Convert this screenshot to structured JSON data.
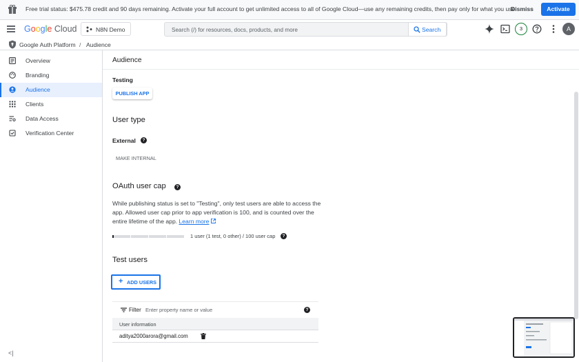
{
  "banner": {
    "message": "Free trial status: $475.78 credit and 90 days remaining. Activate your full account to get unlimited access to all of Google Cloud—use any remaining credits, then pay only for what you use.",
    "dismiss": "Dismiss",
    "activate": "Activate"
  },
  "header": {
    "logo_google": [
      "G",
      "o",
      "o",
      "g",
      "l",
      "e"
    ],
    "logo_cloud": "Cloud",
    "project": "N8N Demo",
    "search_placeholder": "Search (/) for resources, docs, products, and more",
    "search_button": "Search",
    "notifications": "3",
    "avatar": "A"
  },
  "breadcrumb": {
    "root": "Google Auth Platform",
    "separator": "/",
    "current": "Audience"
  },
  "sidebar": {
    "items": [
      {
        "label": "Overview",
        "icon": "dashboard-icon"
      },
      {
        "label": "Branding",
        "icon": "palette-icon"
      },
      {
        "label": "Audience",
        "icon": "person-icon"
      },
      {
        "label": "Clients",
        "icon": "grid-icon"
      },
      {
        "label": "Data Access",
        "icon": "data-access-icon"
      },
      {
        "label": "Verification Center",
        "icon": "verified-icon"
      }
    ],
    "active_index": 2,
    "collapse": "<|"
  },
  "main": {
    "title": "Audience",
    "status_label": "Testing",
    "publish_button": "PUBLISH APP",
    "user_type_heading": "User type",
    "user_type_value": "External",
    "make_internal": "MAKE INTERNAL",
    "cap_heading": "OAuth user cap",
    "cap_text": "While publishing status is set to \"Testing\", only test users are able to access the app. Allowed user cap prior to app verification is 100, and is counted over the entire lifetime of the app.",
    "learn_more": "Learn more",
    "cap_usage": "1 user (1 test, 0 other) / 100 user cap",
    "cap_fraction": 0.01,
    "test_users_heading": "Test users",
    "add_users": "ADD USERS",
    "filter_label": "Filter",
    "filter_placeholder": "Enter property name or value",
    "table_header": "User information",
    "rows": [
      "aditya2000arora@gmail.com"
    ]
  },
  "colors": {
    "accent": "#1a73e8",
    "activate_bg": "#1a73e8",
    "notification_ring": "#188038"
  }
}
